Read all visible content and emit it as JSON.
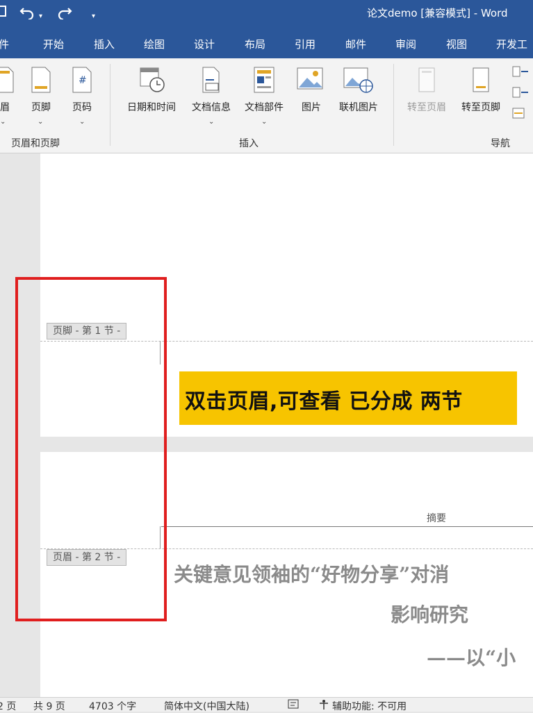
{
  "titlebar": {
    "title": "论文demo [兼容模式] - Word",
    "undo_icon": "undo-icon",
    "redo_icon": "redo-icon"
  },
  "tabs": [
    "件",
    "开始",
    "插入",
    "绘图",
    "设计",
    "布局",
    "引用",
    "邮件",
    "审阅",
    "视图",
    "开发工"
  ],
  "ribbon": {
    "header_footer": {
      "items": [
        "眉",
        "页脚",
        "页码"
      ],
      "group": "页眉和页脚"
    },
    "insert": {
      "items": [
        "日期和时间",
        "文档信息",
        "文档部件",
        "图片",
        "联机图片"
      ],
      "group": "插入"
    },
    "navigation": {
      "items": [
        "转至页眉",
        "转至页脚"
      ],
      "group": "导航"
    },
    "page_number_glyph": "#"
  },
  "document": {
    "footer_tag": "页脚 - 第 1 节 -",
    "header_tag": "页眉 - 第 2 节 -",
    "callout": "双击页眉,可查看 已分成 两节",
    "header_text": "摘要",
    "line1": "关键意见领袖的“好物分享”对消",
    "line2": "影响研究",
    "line3": "——以“小"
  },
  "status": {
    "page": "2 页",
    "total": "共 9 页",
    "words": "4703 个字",
    "lang": "简体中文(中国大陆)",
    "access": "辅助功能: 不可用"
  },
  "colors": {
    "word_blue": "#2b579a",
    "callout": "#f7c400",
    "highlight_red": "#e01e1e"
  }
}
